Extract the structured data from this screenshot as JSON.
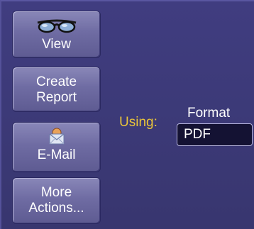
{
  "buttons": {
    "view": {
      "label": "View",
      "icon": "glasses-icon"
    },
    "create_report": {
      "line1": "Create",
      "line2": "Report"
    },
    "email": {
      "label": "E-Mail",
      "icon": "envelope-icon"
    },
    "more_actions": {
      "line1": "More",
      "line2": "Actions..."
    }
  },
  "using": {
    "label": "Using:"
  },
  "format": {
    "label": "Format",
    "value": "PDF"
  },
  "colors": {
    "background": "#3c3a7a",
    "accent_label": "#e9c43a",
    "button_face": "#6f6ca3",
    "field_bg": "#141233"
  }
}
